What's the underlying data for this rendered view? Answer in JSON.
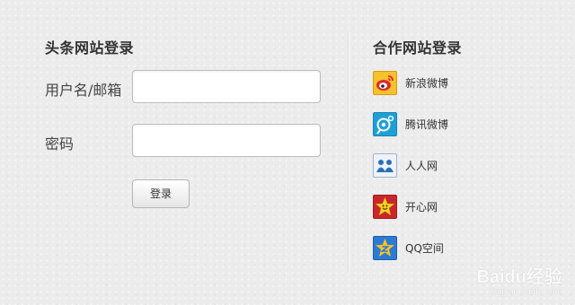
{
  "left": {
    "title": "头条网站登录",
    "username_label": "用户名/邮箱",
    "username_value": "",
    "password_label": "密码",
    "password_value": "",
    "login_button": "登录"
  },
  "right": {
    "title": "合作网站登录",
    "partners": [
      {
        "label": "新浪微博",
        "icon": "sina-weibo-icon",
        "color": "#f2b526"
      },
      {
        "label": "腾讯微博",
        "icon": "tencent-weibo-icon",
        "color": "#1fa2d8"
      },
      {
        "label": "人人网",
        "icon": "renren-icon",
        "color": "#2a6fb5"
      },
      {
        "label": "开心网",
        "icon": "kaixin-icon",
        "color": "#c9262c"
      },
      {
        "label": "QQ空间",
        "icon": "qzone-icon",
        "color": "#2c7ad6"
      }
    ]
  },
  "watermark": {
    "text": "Baidu经验",
    "url": "jingyan.baidu.com"
  }
}
